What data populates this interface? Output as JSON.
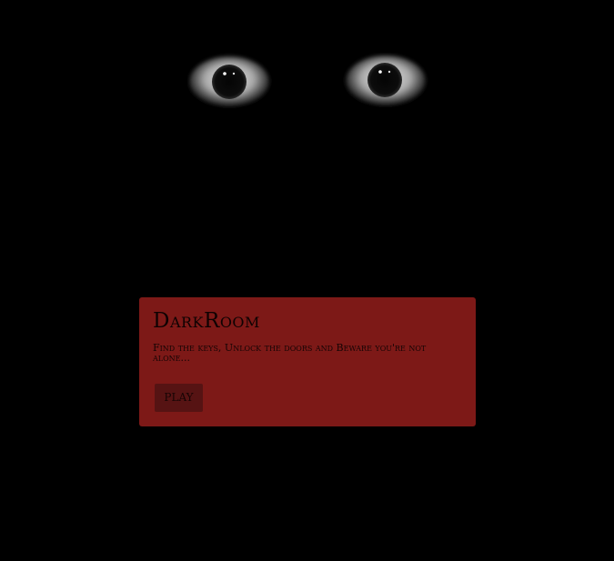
{
  "game": {
    "title": "DarkRoom",
    "description": "Find the keys, Unlock the doors and Beware you're not alone...",
    "play_label": "PLAY"
  },
  "colors": {
    "background": "#000000",
    "panel": "#7d1917",
    "button": "#561313",
    "text": "#0e0202"
  },
  "icons": {
    "left_eye": "eye-icon",
    "right_eye": "eye-icon"
  }
}
